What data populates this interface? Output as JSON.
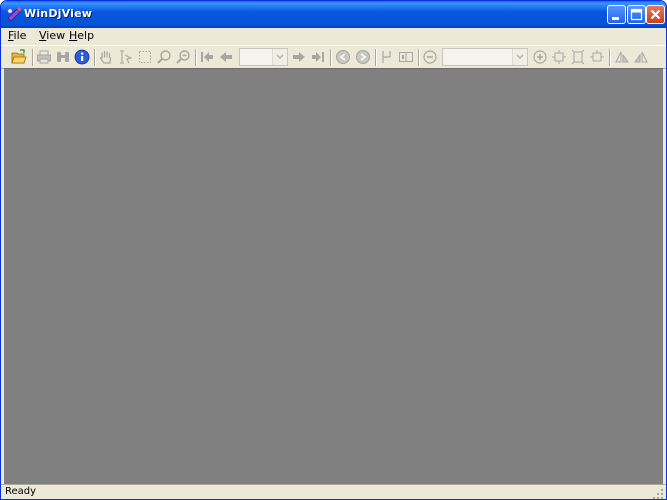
{
  "window": {
    "title": "WinDjView",
    "controls": [
      "minimize-icon",
      "maximize-icon",
      "close-icon"
    ]
  },
  "menubar": {
    "items": [
      {
        "accel": "F",
        "rest": "ile"
      },
      {
        "accel": "V",
        "rest": "iew"
      },
      {
        "accel": "H",
        "rest": "elp"
      }
    ]
  },
  "toolbar": {
    "icons": [
      "open-folder-icon",
      "print-icon",
      "find-binoculars-icon",
      "info-icon",
      "hand-pan-icon",
      "text-select-icon",
      "rect-select-icon",
      "zoom-in-magnifier-icon",
      "zoom-out-magnifier-icon",
      "first-page-icon",
      "prev-page-icon",
      "page-number-combo",
      "next-page-icon",
      "last-page-icon",
      "back-icon",
      "forward-icon",
      "page-layout-icon",
      "two-pages-icon",
      "zoom-out-icon",
      "zoom-combo",
      "zoom-in-icon",
      "fit-page-icon",
      "fit-width-icon",
      "actual-size-icon",
      "rotate-left-icon",
      "rotate-right-icon"
    ],
    "page_number_value": "",
    "zoom_value": ""
  },
  "status": {
    "text": "Ready"
  },
  "colors": {
    "titlebar": "#0553d7",
    "chrome": "#ece9d8",
    "viewport": "#808080",
    "disabled_icon": "#a8a79f",
    "open_icon": "#e8b33b",
    "info_icon": "#2b5fd8"
  }
}
